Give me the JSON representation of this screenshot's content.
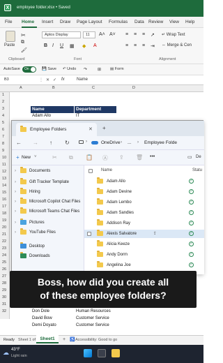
{
  "titlebar": {
    "title": "employee folder.xlsx • Saved"
  },
  "ribbon_tabs": [
    "File",
    "Home",
    "Insert",
    "Draw",
    "Page Layout",
    "Formulas",
    "Data",
    "Review",
    "View",
    "Help"
  ],
  "ribbon": {
    "paste": "Paste",
    "font_name": "Aptos Display",
    "font_size": "11",
    "bold": "B",
    "italic": "I",
    "underline": "U",
    "wrap_text": "Wrap Text",
    "merge": "Merge & Cen",
    "groups": {
      "clipboard": "Clipboard",
      "font": "Font",
      "alignment": "Alignment"
    }
  },
  "qat": {
    "autosave": "AutoSave",
    "toggle": "On",
    "save": "Save",
    "undo": "Undo",
    "redo": "",
    "border": "",
    "form": "Form"
  },
  "formula_bar": {
    "namebox": "B3",
    "fx": "fx",
    "value": "Name"
  },
  "grid": {
    "columns": [
      "A",
      "B",
      "C",
      "D"
    ],
    "rows": [
      "1",
      "2",
      "3",
      "4",
      "5",
      "6",
      "7",
      "8",
      "9",
      "10",
      "11",
      "12",
      "13",
      "14",
      "15",
      "16",
      "17",
      "18",
      "19",
      "20",
      "21",
      "22",
      "23",
      "24",
      "25",
      "26",
      "27",
      "28",
      "29",
      "30",
      "31",
      "32"
    ],
    "header": {
      "name": "Name",
      "dept": "Department"
    },
    "row4": {
      "name": "Adam Allo",
      "dept": "IT"
    },
    "bottom_rows": [
      {
        "name": "Don Dole",
        "dept": "Human Resources"
      },
      {
        "name": "David Bow",
        "dept": "Customer Service"
      },
      {
        "name": "Demi Doyato",
        "dept": "Customer Service"
      }
    ]
  },
  "explorer": {
    "tab_title": "Employee Folders",
    "breadcrumb": [
      "OneDrive",
      "...",
      "Employee Folde"
    ],
    "new_label": "New",
    "more": "•••",
    "details": "De",
    "nav_items": [
      {
        "label": "Documents",
        "expandable": true
      },
      {
        "label": "Gift Tracker Template",
        "expandable": true
      },
      {
        "label": "Hiring",
        "expandable": true
      },
      {
        "label": "Microsoft Copilot Chat Files",
        "expandable": true
      },
      {
        "label": "Microsoft Teams Chat Files",
        "expandable": true
      },
      {
        "label": "Pictures",
        "expandable": true
      },
      {
        "label": "YouTube Files",
        "expandable": true
      },
      {
        "label": "Desktop",
        "expandable": false
      },
      {
        "label": "Downloads",
        "expandable": false
      }
    ],
    "col_name": "Name",
    "col_status": "Statu",
    "files": [
      "Adam Allo",
      "Adam Devine",
      "Adam Lembo",
      "Adam Sandles",
      "Addison Ray",
      "Alexis Salvatore",
      "Alicia Keeze",
      "Andy Dorm",
      "Angelina Joe"
    ],
    "selected_index": 5
  },
  "caption": {
    "line1": "Boss, how did you create all",
    "line2": "of these employee folders?"
  },
  "sheetbar": {
    "ready": "Ready",
    "sheet_nav": "Sheet 1 of 1",
    "tab": "Sheet1",
    "accessibility": "Accessibility: Good to go"
  },
  "taskbar": {
    "temp": "43°F",
    "weather": "Light rain"
  },
  "colors": {
    "excel_green": "#1e6b3c",
    "header_navy": "#1f3864",
    "folder_yellow": "#f3c94c"
  }
}
